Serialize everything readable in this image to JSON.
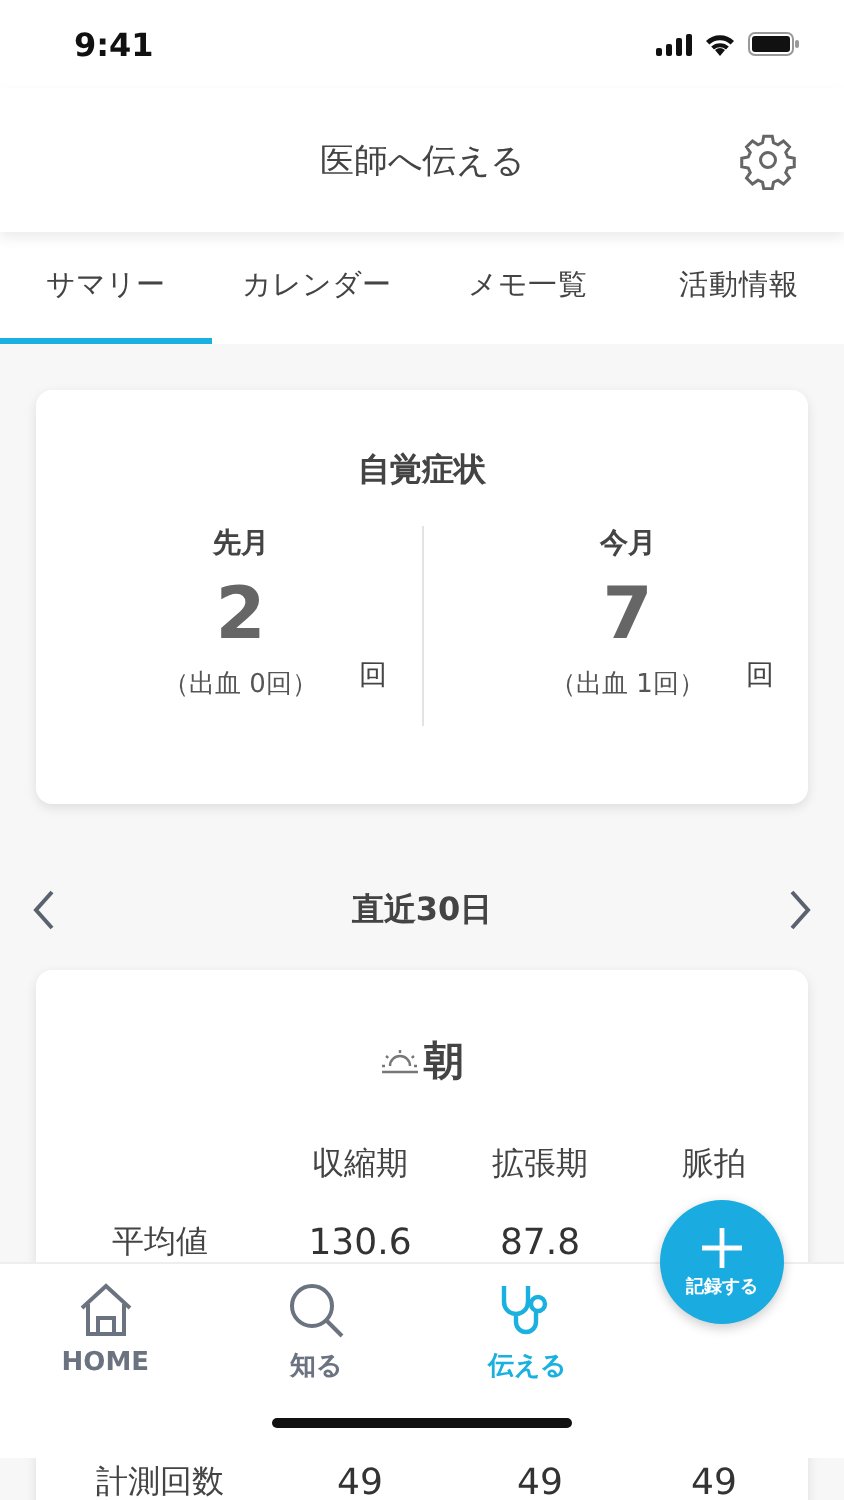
{
  "status_bar": {
    "time": "9:41"
  },
  "header": {
    "title": "医師へ伝える"
  },
  "tabs": [
    {
      "label": "サマリー",
      "selected": true
    },
    {
      "label": "カレンダー",
      "selected": false
    },
    {
      "label": "メモ一覧",
      "selected": false
    },
    {
      "label": "活動情報",
      "selected": false
    }
  ],
  "symptom_card": {
    "title": "自覚症状",
    "periods": [
      {
        "label": "先月",
        "count": "2",
        "unit": "回",
        "note": "（出血 0回）"
      },
      {
        "label": "今月",
        "count": "7",
        "unit": "回",
        "note": "（出血 1回）"
      }
    ]
  },
  "period_nav": {
    "label": "直近30日"
  },
  "bp_card": {
    "title": "朝",
    "columns": [
      "収縮期",
      "拡張期",
      "脈拍"
    ],
    "rows": [
      {
        "label": "平均値",
        "values": [
          "130.6",
          "87.8"
        ]
      },
      {
        "label": "計測回数",
        "values": [
          "49",
          "49",
          "49"
        ]
      }
    ]
  },
  "fab": {
    "label": "記録する"
  },
  "bottom_nav": [
    {
      "label": "HOME",
      "selected": false
    },
    {
      "label": "知る",
      "selected": false
    },
    {
      "label": "伝える",
      "selected": true
    }
  ]
}
